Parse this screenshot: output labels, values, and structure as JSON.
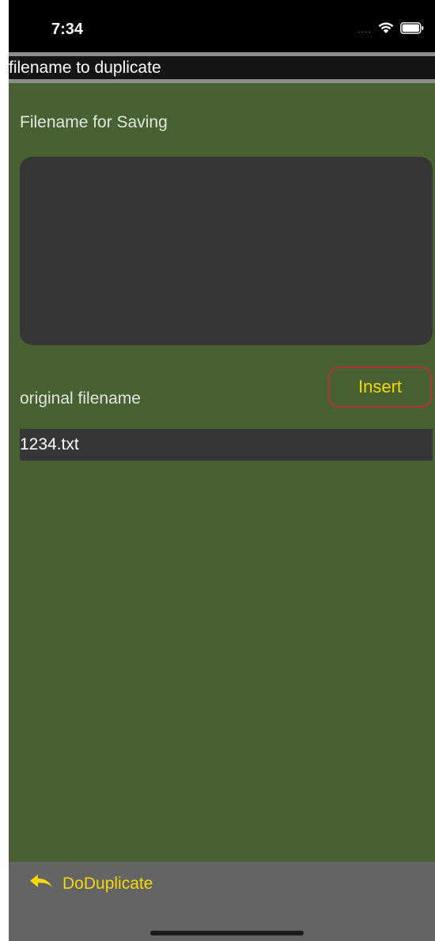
{
  "status_bar": {
    "time": "7:34",
    "signal_dots": "....",
    "icons": [
      "wifi-icon",
      "battery-icon"
    ]
  },
  "header": {
    "title": "filename to duplicate"
  },
  "form": {
    "filename_for_saving_label": "Filename for Saving",
    "filename_for_saving_value": "",
    "original_filename_label": "original filename",
    "original_filename_value": "1234.txt",
    "insert_button_label": "Insert"
  },
  "toolbar": {
    "back_icon": "reply-arrow-icon",
    "action_label": "DoDuplicate"
  },
  "colors": {
    "background": "#486132",
    "accent": "#f4d70a",
    "insert_border": "#b5333b",
    "field_bg": "#363636",
    "toolbar_bg": "#646464"
  }
}
